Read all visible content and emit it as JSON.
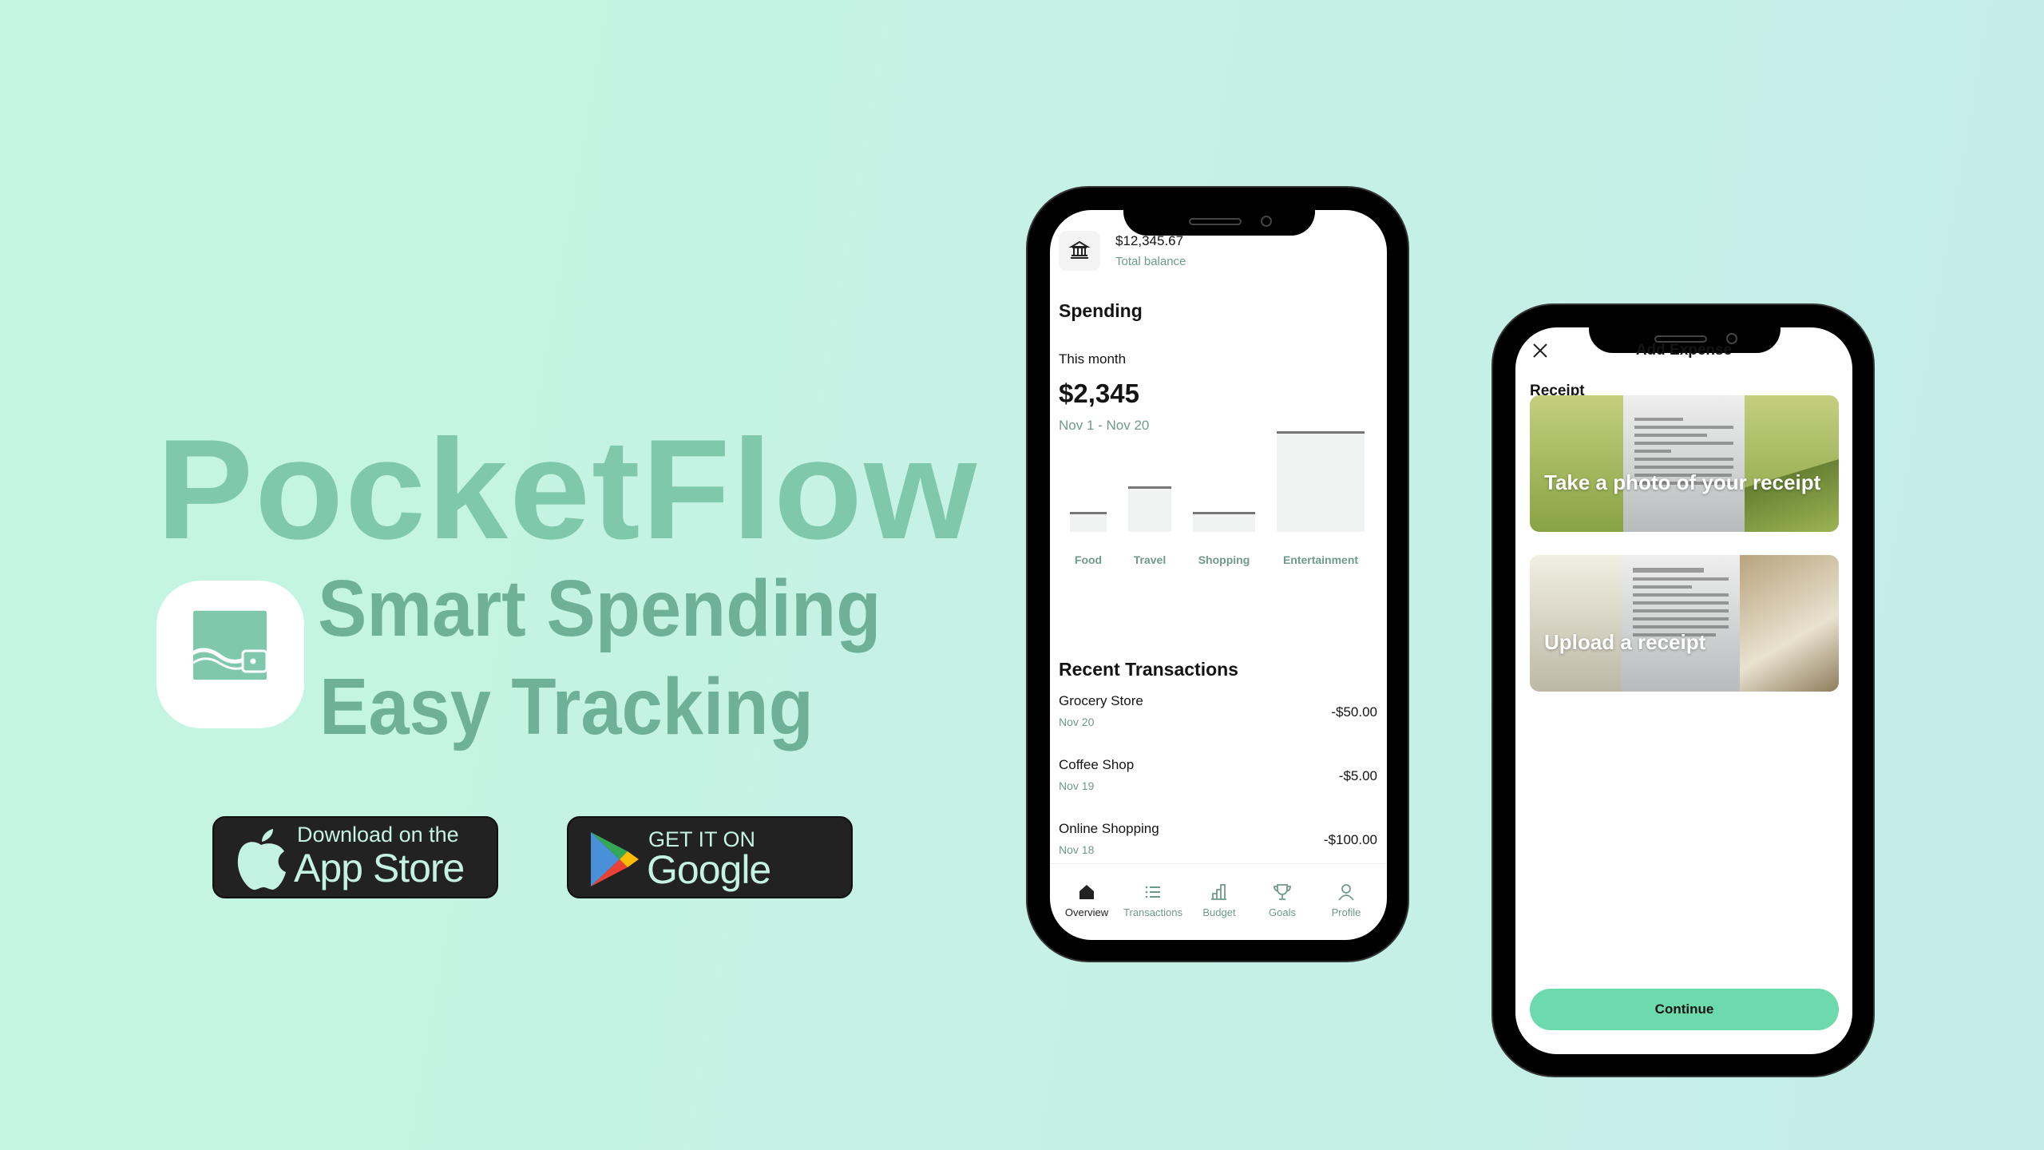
{
  "hero": {
    "app_name": "PocketFlow",
    "tagline_1": "Smart Spending",
    "tagline_2": "Easy Tracking",
    "logo_icon": "wallet-icon",
    "brand_color": "#80c8ac"
  },
  "badges": {
    "app_store": {
      "small": "Download on the",
      "big": "App Store",
      "icon": "apple-icon"
    },
    "google_play": {
      "small": "GET IT ON",
      "big": "Google Play",
      "icon": "google-play-icon"
    }
  },
  "overview_screen": {
    "balance_icon": "bank-icon",
    "balance": "$12,345.67",
    "balance_label": "Total balance",
    "spending_title": "Spending",
    "period_label": "This month",
    "period_total": "$2,345",
    "date_range": "Nov 1 - Nov 20",
    "recent_title": "Recent Transactions",
    "transactions": [
      {
        "name": "Grocery Store",
        "date": "Nov 20",
        "amount": "-$50.00"
      },
      {
        "name": "Coffee Shop",
        "date": "Nov 19",
        "amount": "-$5.00"
      },
      {
        "name": "Online Shopping",
        "date": "Nov 18",
        "amount": "-$100.00"
      }
    ],
    "nav": [
      {
        "label": "Overview",
        "icon": "home-icon",
        "active": true
      },
      {
        "label": "Transactions",
        "icon": "list-icon"
      },
      {
        "label": "Budget",
        "icon": "bar-chart-icon"
      },
      {
        "label": "Goals",
        "icon": "trophy-icon"
      },
      {
        "label": "Profile",
        "icon": "user-icon"
      }
    ]
  },
  "chart_data": {
    "type": "bar",
    "categories": [
      "Food",
      "Travel",
      "Shopping",
      "Entertainment"
    ],
    "values": [
      0.2,
      0.45,
      0.2,
      1.0
    ],
    "grid": false
  },
  "add_expense_screen": {
    "title": "Add Expense",
    "close_icon": "close-icon",
    "section": "Receipt",
    "options": [
      {
        "label": "Take a photo of your receipt"
      },
      {
        "label": "Upload a receipt"
      }
    ],
    "continue_label": "Continue",
    "accent": "#6ddaad"
  }
}
